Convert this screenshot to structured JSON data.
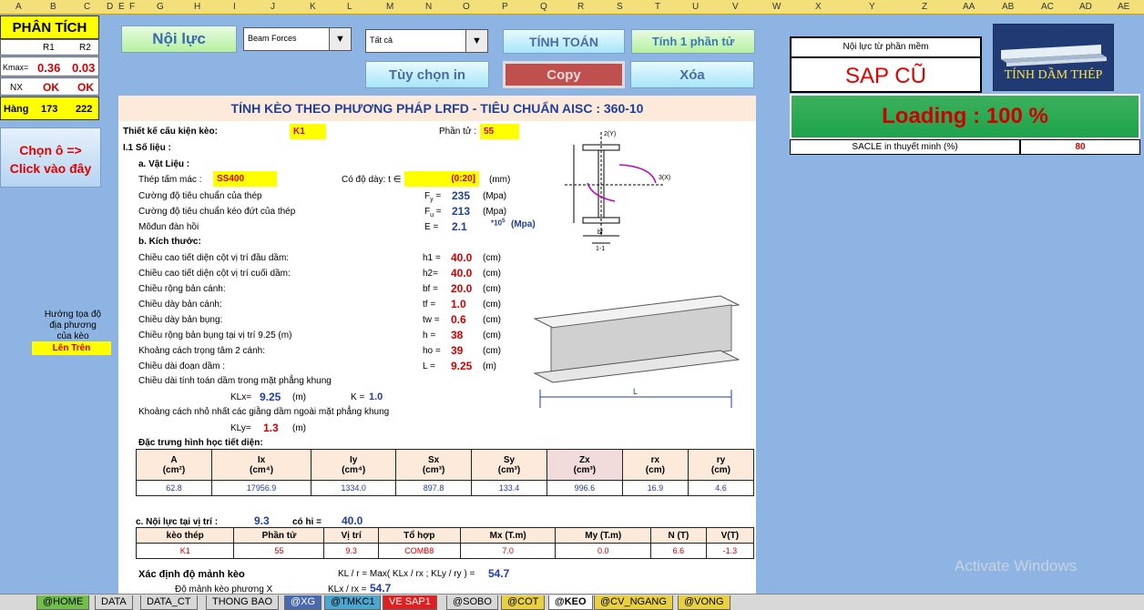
{
  "columns": [
    "A",
    "B",
    "C",
    "D",
    "E",
    "F",
    "G",
    "H",
    "I",
    "J",
    "K",
    "L",
    "M",
    "N",
    "O",
    "P",
    "Q",
    "R",
    "S",
    "T",
    "U",
    "V",
    "W",
    "X",
    "Y",
    "Z",
    "AA",
    "AB",
    "AC",
    "AD",
    "AE"
  ],
  "left": {
    "title": "PHÂN TÍCH",
    "r1": "R1",
    "r2": "R2",
    "kmax_label": "Kmax=",
    "kmax_r1": "0.36",
    "kmax_r2": "0.03",
    "nx_label": "NX",
    "nx_r1": "OK",
    "nx_r2": "OK",
    "hang_label": "Hàng",
    "hang_r1": "173",
    "hang_r2": "222",
    "choose_btn_l1": "Chọn ô =>",
    "choose_btn_l2": "Click vào đây",
    "orient_l1": "Hướng tọa độ",
    "orient_l2": "địa phương",
    "orient_l3": "của kèo",
    "orient_value": "Lên Trên"
  },
  "toolbar": {
    "noi_luc": "Nội lực",
    "drop1": "Beam Forces",
    "drop2": "Tất cả",
    "tinh_toan": "TÍNH TOÁN",
    "tinh_1": "Tính 1 phần tử",
    "tuy_chon": "Tùy chọn in",
    "copy": "Copy",
    "xoa": "Xóa"
  },
  "right": {
    "noi_luc_label": "Nội lực từ phần mềm",
    "sap": "SAP CŨ",
    "logo": "TÍNH DẦM THÉP",
    "loading": "Loading : 100 %",
    "scale_label": "SACLE in thuyết minh (%)",
    "scale_value": "80"
  },
  "sheet": {
    "title": "TÍNH KÈO THEO PHƯƠNG PHÁP LRFD -  TIÊU CHUẨN AISC : 360-10",
    "thiet_ke": "Thiết kế cấu kiện kèo:",
    "thiet_ke_val": "K1",
    "phan_tu": "Phần tử :",
    "phan_tu_val": "55",
    "so_lieu": "I.1   Số liệu :",
    "vat_lieu": "a. Vật Liệu :",
    "thep_tam": "Thép tấm mác :",
    "thep_tam_val": "SS400",
    "do_day": "Có độ dày: t ∈",
    "do_day_val": "(0:20]",
    "mm": "(mm)",
    "material": [
      {
        "label": "Cường độ tiêu chuẩn của thép",
        "sym": "F",
        "sub": "y",
        "val": "235",
        "unit": "(Mpa)"
      },
      {
        "label": "Cường độ tiêu chuẩn kéo đứt của thép",
        "sym": "F",
        "sub": "u",
        "val": "213",
        "unit": "(Mpa)"
      },
      {
        "label": "Môđun đàn hồi",
        "sym": "E",
        "sub": "",
        "val": "2.1",
        "unit": ""
      }
    ],
    "e_exp": "*10",
    "e_exp2": "5",
    "e_unit": "(Mpa)",
    "kich_thuoc": "b. Kích thước:",
    "dims": [
      {
        "label": "Chiều cao tiết diện cột vị trí đầu dầm:",
        "sym": "h1 =",
        "val": "40.0",
        "unit": "(cm)"
      },
      {
        "label": "Chiều cao tiết diện cột vị trí cuối dầm:",
        "sym": "h2=",
        "val": "40.0",
        "unit": "(cm)"
      },
      {
        "label": "Chiều rộng bản cánh:",
        "sym": "bf =",
        "val": "20.0",
        "unit": "(cm)"
      },
      {
        "label": "Chiều dày bản cánh:",
        "sym": "tf =",
        "val": "1.0",
        "unit": "(cm)"
      },
      {
        "label": "Chiều dày bản bụng:",
        "sym": "tw =",
        "val": "0.6",
        "unit": "(cm)"
      },
      {
        "label": "Chiều rộng bản bụng tại vị trí    9.25  (m)",
        "sym": "h =",
        "val": "38",
        "unit": "(cm)"
      },
      {
        "label": "Khoảng cách trọng tâm 2 cánh:",
        "sym": "ho =",
        "val": "39",
        "unit": "(cm)"
      },
      {
        "label": "Chiều dài đoạn dầm :",
        "sym": "L =",
        "val": "9.25",
        "unit": "(m)"
      }
    ],
    "chieu_dai_tt": "Chiều dài tính toán dầm trong mặt phẳng khung",
    "klx_label": "KLx=",
    "klx_val": "9.25",
    "klx_unit": "(m)",
    "k_label": "K =",
    "k_val": "1.0",
    "khoang_cach": "Khoảng cách nhỏ nhất các giằng dầm ngoài mặt phẳng khung",
    "kly_label": "KLy=",
    "kly_val": "1.3",
    "kly_unit": "(m)",
    "dac_trung": "Đặc trưng hình học tiết diện:",
    "geo_head": [
      "A\n(cm²)",
      "Ix\n(cm⁴)",
      "Iy\n(cm⁴)",
      "Sx\n(cm³)",
      "Sy\n(cm³)",
      "Zx\n(cm³)",
      "rx\n(cm)",
      "ry\n(cm)"
    ],
    "geo_vals": [
      "62.8",
      "17956.9",
      "1334.0",
      "897.8",
      "133.4",
      "996.6",
      "16.9",
      "4.6"
    ],
    "noi_luc_tai": "c. Nội lực tại vị trí :",
    "vt_val": "9.3",
    "co_hi": "có hi =",
    "co_hi_val": "40.0",
    "force_head": [
      "kèo thép",
      "Phần tử",
      "Vị trí",
      "Tổ hợp",
      "Mx (T.m)",
      "My (T.m)",
      "N (T)",
      "V(T)"
    ],
    "force_vals": [
      "K1",
      "55",
      "9.3",
      "COMB8",
      "7.0",
      "0.0",
      "6.6",
      "-1.3"
    ],
    "do_manh": "Xác định độ mảnh kèo",
    "kl_r": "KL / r = Max(  KLx / rx ; KLy / ry ) =",
    "kl_r_val": "54.7",
    "do_manh_x": "Độ mảnh kèo phương X",
    "do_manh_x_eq": "KLx / rx =",
    "do_manh_x_val": "54.7"
  },
  "diagram": {
    "axis_z": "2(Y)",
    "axis_x": "3(X)",
    "label_11": "1-1",
    "label_bf": "bf",
    "label_L": "L"
  },
  "tabs": [
    "@HOME",
    "DATA",
    "DATA_CT",
    "THONG BAO",
    "@XG",
    "@TMKC1",
    "VE SAP1",
    "@SOBO",
    "@COT",
    "@KEO",
    "@CV_NGANG",
    "@VONG"
  ],
  "watermark": "Activate Windows"
}
